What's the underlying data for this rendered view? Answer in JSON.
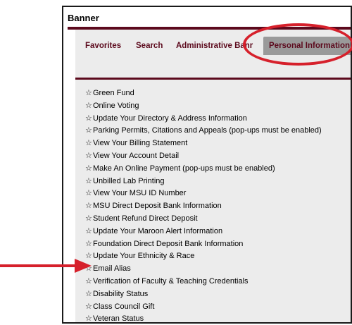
{
  "app": {
    "title": "Banner"
  },
  "tabs": [
    {
      "label": "Favorites",
      "active": false
    },
    {
      "label": "Search",
      "active": false
    },
    {
      "label": "Administrative Banr",
      "active": false
    },
    {
      "label": "Personal Information",
      "active": true
    }
  ],
  "menu": {
    "star_glyph": "☆",
    "items": [
      "Green Fund",
      "Online Voting",
      "Update Your Directory & Address Information",
      "Parking Permits, Citations and Appeals (pop-ups must be enabled)",
      "View Your Billing Statement",
      "View Your Account Detail",
      "Make An Online Payment (pop-ups must be enabled)",
      "Unbilled Lab Printing",
      "View Your MSU ID Number",
      "MSU Direct Deposit Bank Information",
      "Student Refund Direct Deposit",
      "Update Your Maroon Alert Information",
      "Foundation Direct Deposit Bank Information",
      "Update Your Ethnicity & Race",
      "Email Alias",
      "Verification of Faculty & Teaching Credentials",
      "Disability Status",
      "Class Council Gift",
      "Veteran Status"
    ]
  },
  "annotations": {
    "highlight_color": "#d6202b",
    "pointed_item": "Email Alias"
  },
  "colors": {
    "brand": "#5c0a1d",
    "panel": "#ececec",
    "active_tab": "#9a9a9a"
  }
}
